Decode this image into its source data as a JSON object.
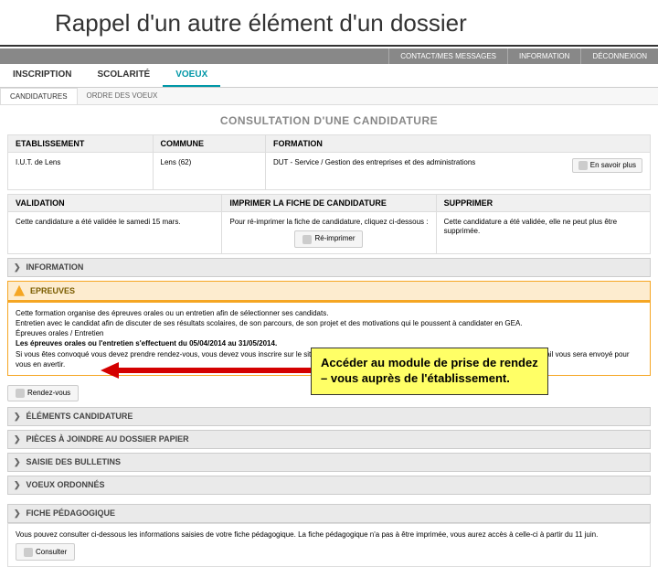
{
  "slide": {
    "title": "Rappel d'un autre élément d'un dossier"
  },
  "topbar": {
    "contact": "CONTACT/MES MESSAGES",
    "info": "INFORMATION",
    "logout": "DÉCONNEXION"
  },
  "mainnav": {
    "inscription": "INSCRIPTION",
    "scolarite": "SCOLARITÉ",
    "voeux": "VOEUX"
  },
  "subnav": {
    "candidatures": "CANDIDATURES",
    "ordre": "ORDRE DES VOEUX"
  },
  "page_heading": "CONSULTATION D'UNE CANDIDATURE",
  "columns1": {
    "etab_h": "ETABLISSEMENT",
    "commune_h": "COMMUNE",
    "formation_h": "FORMATION",
    "etab_v": "I.U.T. de Lens",
    "commune_v": "Lens (62)",
    "formation_v": "DUT - Service / Gestion des entreprises et des administrations",
    "savoir_plus": "En savoir plus"
  },
  "columns2": {
    "val_h": "VALIDATION",
    "imp_h": "IMPRIMER LA FICHE DE CANDIDATURE",
    "sup_h": "SUPPRIMER",
    "val_v": "Cette candidature a été validée le samedi 15 mars.",
    "imp_v": "Pour ré-imprimer la fiche de candidature, cliquez ci-dessous :",
    "imp_btn": "Ré-imprimer",
    "sup_v": "Cette candidature a été validée, elle ne peut plus être supprimée."
  },
  "sections": {
    "information": "INFORMATION",
    "epreuves": "EPREUVES",
    "elements": "ÉLÉMENTS CANDIDATURE",
    "pieces": "PIÈCES À JOINDRE AU DOSSIER PAPIER",
    "bulletins": "SAISIE DES BULLETINS",
    "voeux_ord": "VOEUX ORDONNÉS",
    "fiche": "FICHE PÉDAGOGIQUE"
  },
  "epreuves_text": {
    "l1": "Cette formation organise des épreuves orales ou un entretien afin de sélectionner ses candidats.",
    "l2": "Entretien avec le candidat afin de discuter de ses résultats scolaires, de son parcours, de son projet et des motivations qui le poussent à candidater en GEA.",
    "l3": "Épreuves orales / Entretien",
    "l4": "Les épreuves orales ou l'entretien s'effectuent du 05/04/2014 au 31/05/2014.",
    "l5": "Si vous êtes convoqué vous devez prendre rendez-vous, vous devez vous inscrire sur le site entre le 01/03/2014 et 05/04/2014 afin de prendre rendez-vous. Un email vous sera envoyé pour vous en avertir."
  },
  "rdv_btn": "Rendez-vous",
  "callout": "Accéder au module de prise de rendez – vous auprès de l'établissement.",
  "fiche_text": "Vous pouvez consulter ci-dessous les informations saisies de votre fiche pédagogique. La fiche pédagogique n'a pas à être imprimée, vous aurez accès à celle-ci à partir du 11 juin.",
  "consulter_btn": "Consulter"
}
